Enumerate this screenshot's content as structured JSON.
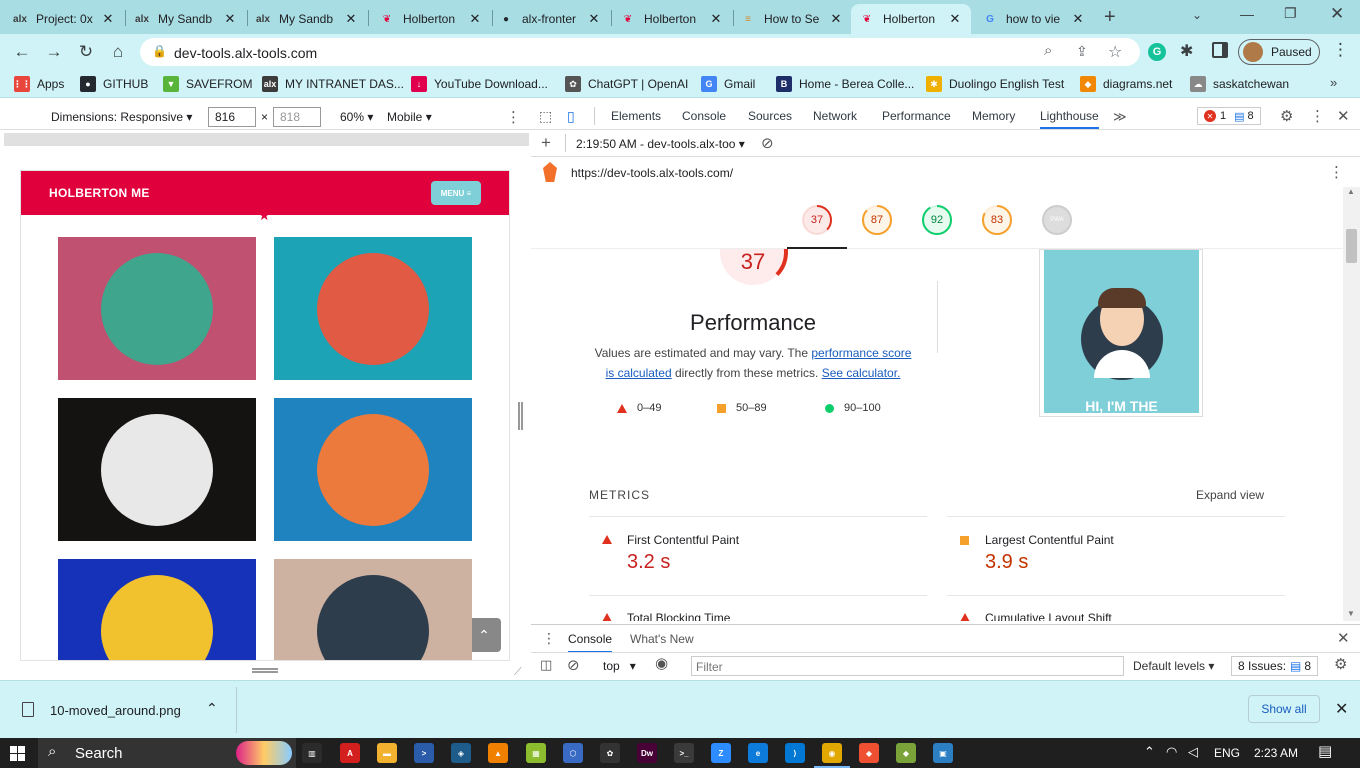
{
  "browser": {
    "tabs": [
      {
        "title": "Project: 0x",
        "icon": "alx-logo-icon",
        "favText": "alx",
        "favColor": "#3c3c3c"
      },
      {
        "title": "My Sandb",
        "icon": "alx-logo-icon",
        "favText": "alx",
        "favColor": "#3c3c3c"
      },
      {
        "title": "My Sandb",
        "icon": "alx-logo-icon",
        "favText": "alx",
        "favColor": "#3c3c3c"
      },
      {
        "title": "Holberton",
        "icon": "holberton-logo-icon",
        "favText": "❦",
        "favColor": "#e0003c"
      },
      {
        "title": "alx-fronter",
        "icon": "github-logo-icon",
        "favText": "●",
        "favColor": "#24292f"
      },
      {
        "title": "Holberton",
        "icon": "holberton-logo-icon",
        "favText": "❦",
        "favColor": "#e0003c"
      },
      {
        "title": "How to Se",
        "icon": "stackoverflow-logo-icon",
        "favText": "≡",
        "favColor": "#d48a2c"
      },
      {
        "title": "Holberton",
        "icon": "holberton-logo-icon",
        "favText": "❦",
        "favColor": "#e0003c",
        "active": true
      },
      {
        "title": "how to vie",
        "icon": "google-logo-icon",
        "favText": "G",
        "favColor": "#4285f4"
      }
    ],
    "url": "dev-tools.alx-tools.com",
    "profile_label": "Paused",
    "bookmarks": [
      {
        "label": "Apps",
        "icon": "apps-grid-icon",
        "glyph": "⋮⋮",
        "color": "#e8453c"
      },
      {
        "label": "GITHUB",
        "icon": "github-logo-icon",
        "glyph": "●",
        "color": "#24292f"
      },
      {
        "label": "SAVEFROM",
        "icon": "savefrom-logo-icon",
        "glyph": "▼",
        "color": "#59b53a"
      },
      {
        "label": "MY INTRANET DAS...",
        "icon": "alx-logo-icon",
        "glyph": "alx",
        "color": "#3c3c3c"
      },
      {
        "label": "YouTube Download...",
        "icon": "youtube-downloader-icon",
        "glyph": "↓",
        "color": "#e0004d"
      },
      {
        "label": "ChatGPT | OpenAI",
        "icon": "openai-logo-icon",
        "glyph": "✿",
        "color": "#555555"
      },
      {
        "label": "Gmail",
        "icon": "google-logo-icon",
        "glyph": "G",
        "color": "#4285f4"
      },
      {
        "label": "Home - Berea Colle...",
        "icon": "berea-logo-icon",
        "glyph": "B",
        "color": "#1d2e6b"
      },
      {
        "label": "Duolingo English Test",
        "icon": "duolingo-logo-icon",
        "glyph": "✱",
        "color": "#f0b000"
      },
      {
        "label": "diagrams.net",
        "icon": "diagrams-logo-icon",
        "glyph": "◆",
        "color": "#f08705"
      },
      {
        "label": "saskatchewan",
        "icon": "cloud-icon",
        "glyph": "☁",
        "color": "#888888"
      }
    ]
  },
  "device_toolbar": {
    "dimensions_label": "Dimensions: Responsive",
    "width": "816",
    "height_placeholder": "818",
    "times": "×",
    "zoom": "60%",
    "device": "Mobile"
  },
  "site": {
    "brand": "HOLBERTON ME",
    "menu": "MENU ≡",
    "brand_color": "#e0003c",
    "cards": [
      {
        "icon": "log-cabin-icon",
        "bg": "#c05170",
        "circle": "#3fa58c"
      },
      {
        "icon": "cake-slice-icon",
        "bg": "#1ca3b5",
        "circle": "#e05a44"
      },
      {
        "icon": "circus-tent-icon",
        "bg": "#151212",
        "circle": "#e8e8e8"
      },
      {
        "icon": "gamepad-icon",
        "bg": "#1f83c0",
        "circle": "#ec7a3c"
      },
      {
        "icon": "safe-icon",
        "bg": "#1532b8",
        "circle": "#f2c12e"
      },
      {
        "icon": "submarine-icon",
        "bg": "#cdb1a1",
        "circle": "#2d3d4c"
      }
    ]
  },
  "devtools": {
    "tabs": [
      "Elements",
      "Console",
      "Sources",
      "Network",
      "Performance",
      "Memory",
      "Lighthouse"
    ],
    "active_tab": "Lighthouse",
    "error_count": "1",
    "message_count": "8",
    "report_time": "2:19:50 AM - dev-tools.alx-too",
    "report_url": "https://dev-tools.alx-tools.com/",
    "gauges": [
      {
        "value": "37",
        "color": "#e0301e",
        "fill": 0.37
      },
      {
        "value": "87",
        "color": "#f4a02a",
        "fill": 0.87
      },
      {
        "value": "92",
        "color": "#0cce6b",
        "fill": 0.92
      },
      {
        "value": "83",
        "color": "#f4a02a",
        "fill": 0.83
      },
      {
        "value": "PWA",
        "color": "#aaaaaa",
        "fill": 0
      }
    ],
    "performance": {
      "score": "37",
      "title": "Performance",
      "desc_1": "Values are estimated and may vary. The",
      "desc_link_1": "performance score",
      "desc_link_1b": "is calculated",
      "desc_2": "directly from these metrics.",
      "desc_link_2": "See calculator.",
      "legend": [
        {
          "label": "0–49",
          "shape": "triangle",
          "color": "#e0301e"
        },
        {
          "label": "50–89",
          "shape": "square",
          "color": "#f4a02a"
        },
        {
          "label": "90–100",
          "shape": "circle",
          "color": "#0cce6b"
        }
      ],
      "screenshot_text": "HI, I'M THE"
    },
    "metrics": {
      "heading": "METRICS",
      "expand": "Expand view",
      "items": [
        {
          "label": "First Contentful Paint",
          "value": "3.2 s",
          "status": "fail"
        },
        {
          "label": "Largest Contentful Paint",
          "value": "3.9 s",
          "status": "average"
        },
        {
          "label": "Total Blocking Time",
          "value": "",
          "status": "fail"
        },
        {
          "label": "Cumulative Layout Shift",
          "value": "",
          "status": "fail"
        }
      ]
    },
    "drawer": {
      "tabs": [
        "Console",
        "What's New"
      ],
      "context": "top",
      "filter_placeholder": "Filter",
      "levels": "Default levels",
      "issues_label": "8 Issues:",
      "issues_count": "8"
    }
  },
  "download": {
    "filename": "10-moved_around.png",
    "show_all": "Show all"
  },
  "taskbar": {
    "search": "Search",
    "lang": "ENG",
    "time": "2:23 AM",
    "apps": [
      {
        "icon": "task-view-icon",
        "glyph": "▥",
        "color": "#2b2b2b"
      },
      {
        "icon": "acrobat-icon",
        "glyph": "A",
        "color": "#d41f1f"
      },
      {
        "icon": "file-explorer-icon",
        "glyph": "▬",
        "color": "#f2b230"
      },
      {
        "icon": "powershell-icon",
        "glyph": ">",
        "color": "#2a5caa"
      },
      {
        "icon": "network-icon",
        "glyph": "◈",
        "color": "#1e5c8c"
      },
      {
        "icon": "vlc-icon",
        "glyph": "▲",
        "color": "#f08000"
      },
      {
        "icon": "store-icon",
        "glyph": "▦",
        "color": "#8bbd2f"
      },
      {
        "icon": "virtualbox-icon",
        "glyph": "⬡",
        "color": "#3a6bc4"
      },
      {
        "icon": "chatgpt-icon",
        "glyph": "✿",
        "color": "#333333"
      },
      {
        "icon": "dreamweaver-icon",
        "glyph": "Dw",
        "color": "#470137"
      },
      {
        "icon": "terminal-icon",
        "glyph": ">_",
        "color": "#3a3a3a"
      },
      {
        "icon": "zoom-icon",
        "glyph": "Z",
        "color": "#2d8cff"
      },
      {
        "icon": "edge-icon",
        "glyph": "e",
        "color": "#0c7bd9"
      },
      {
        "icon": "vscode-icon",
        "glyph": "⟩",
        "color": "#0078d4"
      },
      {
        "icon": "chrome-icon",
        "glyph": "◉",
        "color": "#e0a800"
      },
      {
        "icon": "git-icon",
        "glyph": "◆",
        "color": "#f05032"
      },
      {
        "icon": "git-gui-icon",
        "glyph": "◆",
        "color": "#7aa33a"
      },
      {
        "icon": "photos-icon",
        "glyph": "▣",
        "color": "#2d7fc4"
      }
    ]
  }
}
